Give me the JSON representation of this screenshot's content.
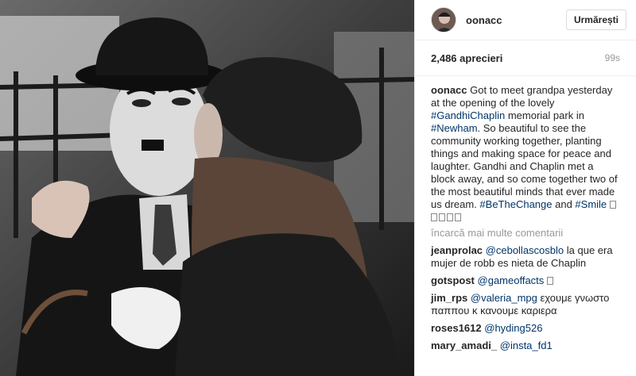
{
  "post": {
    "username": "oonacc",
    "follow_label": "Urmărești",
    "likes": "2,486 aprecieri",
    "age": "99s"
  },
  "caption": {
    "username": "oonacc",
    "t1": " Got to meet grandpa yesterday at the opening of the lovely ",
    "tag1": "#GandhiChaplin",
    "t2": " memorial park in ",
    "tag2": "#Newham",
    "t3": ". So beautiful to see the community working together, planting things and making space for peace and laughter. Gandhi and Chaplin met a block away, and so come together two of the most beautiful minds that ever made us dream. ",
    "tag3": "#BeTheChange",
    "t4": " and ",
    "tag4": "#Smile"
  },
  "load_more": "încarcă mai multe comentarii",
  "comments": [
    {
      "user": "jeanprolac",
      "mention": "@cebollascosblo",
      "text": " la que era mujer de robb es nieta de Chaplin"
    },
    {
      "user": "gotspost",
      "mention": "@gameoffacts",
      "text": ""
    },
    {
      "user": "jim_rps",
      "mention": "@valeria_mpg",
      "text": " εχουμε γνωστο παππου κ κανουμε καριερα"
    },
    {
      "user": "roses1612",
      "mention": "@hyding526",
      "text": ""
    },
    {
      "user": "mary_amadi_",
      "mention": "@insta_fd1",
      "text": ""
    }
  ],
  "colors": {
    "link": "#003569",
    "muted": "#999999",
    "text": "#262626"
  }
}
